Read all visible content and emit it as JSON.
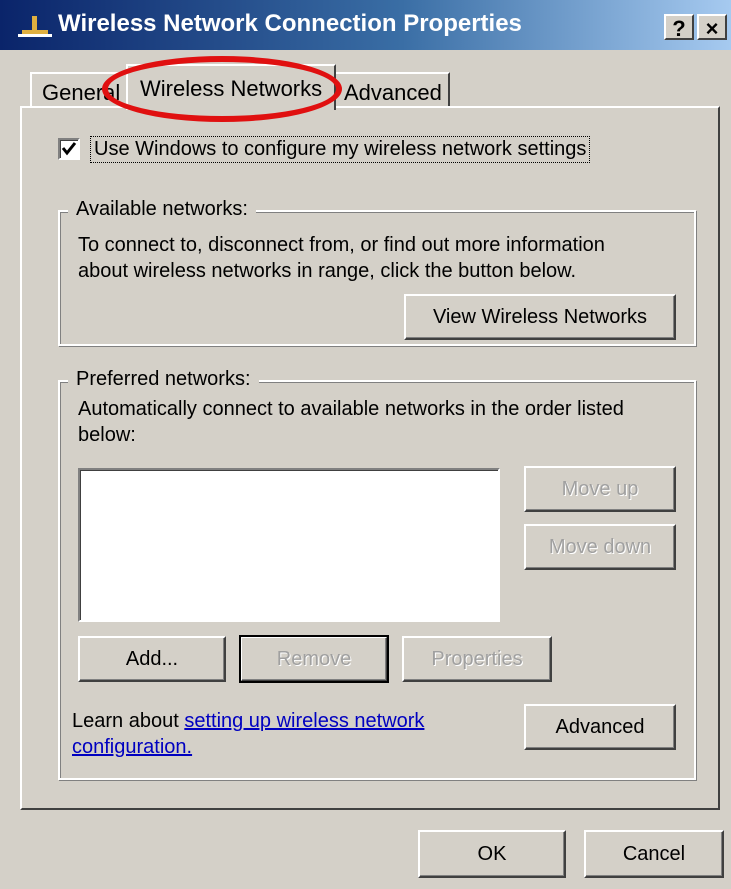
{
  "window": {
    "title": "Wireless Network Connection Properties",
    "help_label": "?",
    "close_label": "×"
  },
  "tabs": [
    {
      "label": "General",
      "active": false
    },
    {
      "label": "Wireless Networks",
      "active": true
    },
    {
      "label": "Advanced",
      "active": false
    }
  ],
  "config_checkbox": {
    "label": "Use Windows to configure my wireless network settings",
    "checked": true
  },
  "available_networks": {
    "legend": "Available networks:",
    "description_line1": "To connect to, disconnect from, or find out more information",
    "description_line2": "about wireless networks in range, click the button below.",
    "view_button": "View Wireless Networks"
  },
  "preferred_networks": {
    "legend": "Preferred networks:",
    "description_line1": "Automatically connect to available networks in the order listed",
    "description_line2": "below:",
    "items": [],
    "move_up": "Move up",
    "move_down": "Move down",
    "add": "Add...",
    "remove": "Remove",
    "properties": "Properties"
  },
  "learn": {
    "prefix": "Learn about ",
    "link_line1": "setting up wireless network",
    "link_line2": "configuration.",
    "advanced_button": "Advanced"
  },
  "footer": {
    "ok": "OK",
    "cancel": "Cancel"
  },
  "annotation": {
    "highlight_color": "#e01010"
  }
}
